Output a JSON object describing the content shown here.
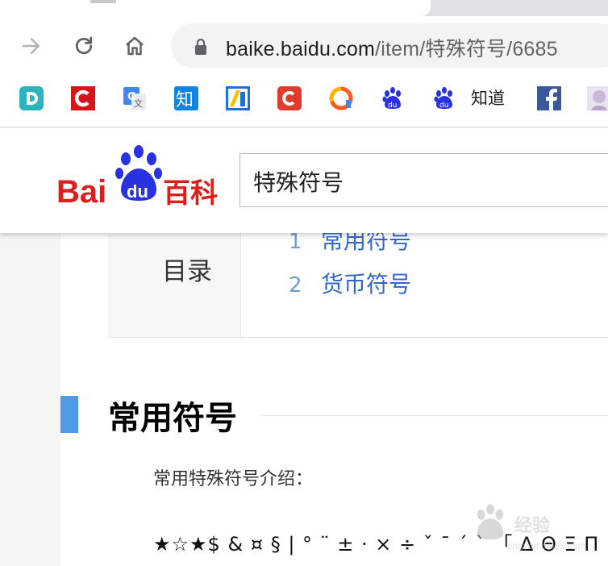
{
  "browser": {
    "address_bar": {
      "host": "baike.baidu.com",
      "path": "/item/特殊符号/6685"
    },
    "bookmarks_bar": {
      "items": [
        {
          "icon": "d-app-icon",
          "color": "#2bb3c0"
        },
        {
          "icon": "c-red-app-icon",
          "color": "#d7141a"
        },
        {
          "icon": "translate-icon",
          "color": "#4285f4"
        },
        {
          "icon": "zhihu-icon",
          "color": "#0e84e5"
        },
        {
          "icon": "stripe-app-icon",
          "color": "#1e6fd9"
        },
        {
          "icon": "c-rounded-app-icon",
          "color": "#e03b2b"
        },
        {
          "icon": "ring-app-icon",
          "color": "#ff6a00"
        },
        {
          "icon": "baidu-paw-icon",
          "color": "#2932e1"
        },
        {
          "icon": "baidu-zhidao-icon",
          "color": "#2932e1"
        },
        {
          "icon": "facebook-icon",
          "color": "#3b5998"
        },
        {
          "icon": "anime-avatar-icon",
          "color": "#c9b8d8"
        }
      ],
      "zhidao_label": "知道"
    }
  },
  "header": {
    "logo_text": "Bai du 百科",
    "search_query": "特殊符号"
  },
  "toc": {
    "title": "目录",
    "items": [
      {
        "num": "1",
        "label": "常用符号"
      },
      {
        "num": "2",
        "label": "货币符号"
      }
    ]
  },
  "section": {
    "title": "常用符号",
    "intro": "常用特殊符号介绍：",
    "symbols": "★☆★$ & ¤ § | °  ¨ ± · × ÷ ˇ ˉ ˊ ˋ 「 Δ Θ Ξ Π Σ"
  },
  "watermark": {
    "text": "经验",
    "sub": "jingyan.baidu.com"
  },
  "colors": {
    "link": "#3366cc",
    "section_accent": "#4e9ae6",
    "baidu_red": "#de1e1b",
    "baidu_blue": "#2932e1"
  }
}
